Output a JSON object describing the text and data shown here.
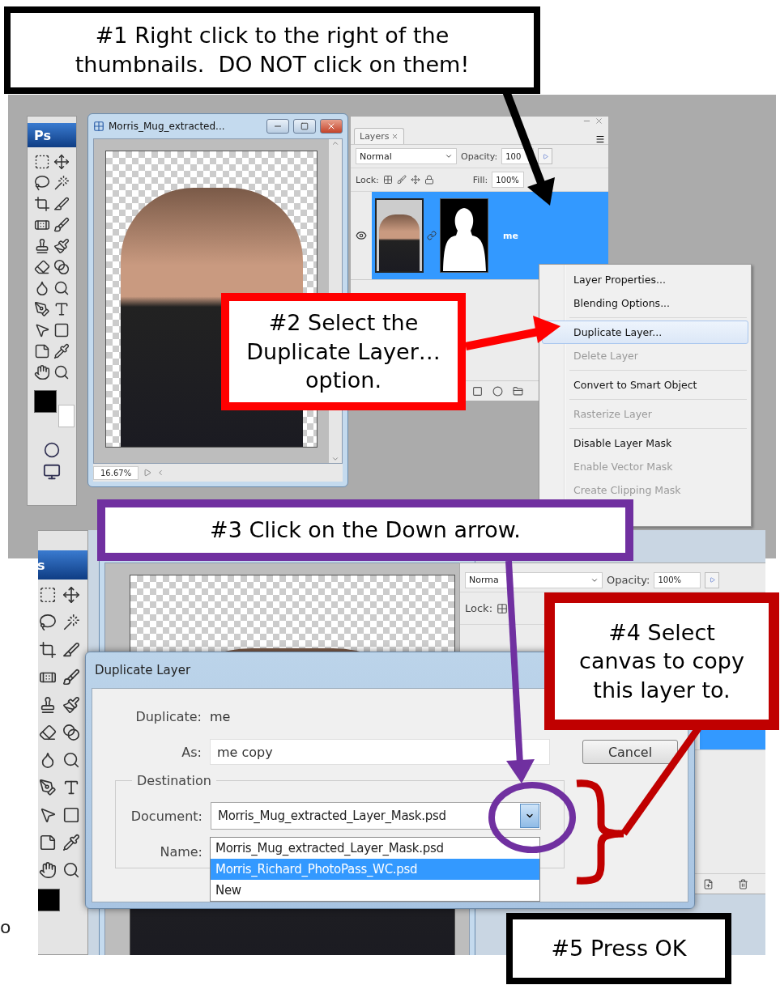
{
  "callouts": [
    {
      "text": "#1 Right click to the right of the thumbnails.  DO NOT click on them!",
      "color": "#000000"
    },
    {
      "text": "#2 Select the Duplicate Layer… option.",
      "color": "#ff0000"
    },
    {
      "text": "#3 Click on the Down arrow.",
      "color": "#7030a0"
    },
    {
      "text": "#4 Select canvas to copy this layer to.",
      "color": "#c00000"
    },
    {
      "text": "#5 Press OK",
      "color": "#000000"
    }
  ],
  "top_screenshot": {
    "toolbox": {
      "logo": "Ps"
    },
    "document_window": {
      "title": "Morris_Mug_extracted...",
      "zoom": "16.67%"
    },
    "layers_panel": {
      "tab": "Layers",
      "blend_mode": "Normal",
      "opacity_label": "Opacity:",
      "opacity": "100",
      "lock_label": "Lock:",
      "fill_label": "Fill:",
      "fill": "100%",
      "layers": [
        {
          "name": "me",
          "selected": true,
          "visible": true
        }
      ]
    },
    "context_menu": {
      "items": [
        {
          "kind": "item",
          "label": "Layer Properties...",
          "disabled": false,
          "selected": false
        },
        {
          "kind": "item",
          "label": "Blending Options...",
          "disabled": false,
          "selected": false
        },
        {
          "kind": "separator"
        },
        {
          "kind": "item",
          "label": "Duplicate Layer...",
          "disabled": false,
          "selected": true
        },
        {
          "kind": "item",
          "label": "Delete Layer",
          "disabled": true,
          "selected": false
        },
        {
          "kind": "separator"
        },
        {
          "kind": "item",
          "label": "Convert to Smart Object",
          "disabled": false,
          "selected": false
        },
        {
          "kind": "separator"
        },
        {
          "kind": "item",
          "label": "Rasterize Layer",
          "disabled": true,
          "selected": false
        },
        {
          "kind": "separator"
        },
        {
          "kind": "item",
          "label": "Disable Layer Mask",
          "disabled": false,
          "selected": false
        },
        {
          "kind": "item",
          "label": "Enable Vector Mask",
          "disabled": true,
          "selected": false
        },
        {
          "kind": "item",
          "label": "Create Clipping Mask",
          "disabled": true,
          "selected": false
        }
      ]
    }
  },
  "bottom_screenshot": {
    "toolbox": {
      "logo": "s"
    },
    "layers_panel": {
      "blend_mode": "Norma",
      "opacity_label": "Opacity:",
      "opacity": "100%",
      "lock_label": "Lock:"
    },
    "dialog": {
      "title": "Duplicate Layer",
      "duplicate_label": "Duplicate:",
      "duplicate_value": "me",
      "as_label": "As:",
      "as_value": "me copy",
      "cancel_button": "Cancel",
      "destination_label": "Destination",
      "document_label": "Document:",
      "document_value": "Morris_Mug_extracted_Layer_Mask.psd",
      "name_label": "Name:",
      "options": [
        {
          "label": "Morris_Mug_extracted_Layer_Mask.psd",
          "selected": false
        },
        {
          "label": "Morris_Richard_PhotoPass_WC.psd",
          "selected": true
        },
        {
          "label": "New",
          "selected": false
        }
      ]
    }
  },
  "stray_text": "o"
}
